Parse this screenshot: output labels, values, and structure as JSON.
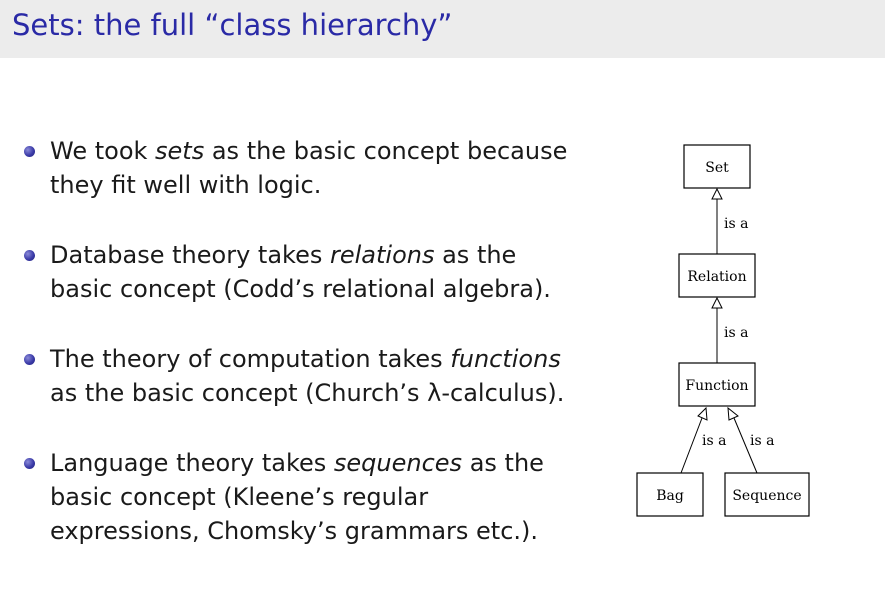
{
  "slide": {
    "title": "Sets: the full “class hierarchy”"
  },
  "bullets": [
    {
      "pre": "We took ",
      "em": "sets",
      "post": " as the basic concept because they fit well with logic."
    },
    {
      "pre": "Database theory takes ",
      "em": "relations",
      "post": " as the basic concept (Codd’s relational algebra)."
    },
    {
      "pre": "The theory of computation takes ",
      "em": "functions",
      "post": " as the basic concept (Church’s λ-calculus)."
    },
    {
      "pre": "Language theory takes ",
      "em": "sequences",
      "post": " as the basic concept (Kleene’s regular expressions, Chomsky’s grammars etc.)."
    }
  ],
  "hierarchy": {
    "nodes": {
      "set": "Set",
      "relation": "Relation",
      "function": "Function",
      "bag": "Bag",
      "sequence": "Sequence"
    },
    "edge_label": "is a"
  },
  "colors": {
    "title": "#2a2aa6",
    "title_bar": "#ececec",
    "bullet_dot": "#3b3ba8"
  }
}
